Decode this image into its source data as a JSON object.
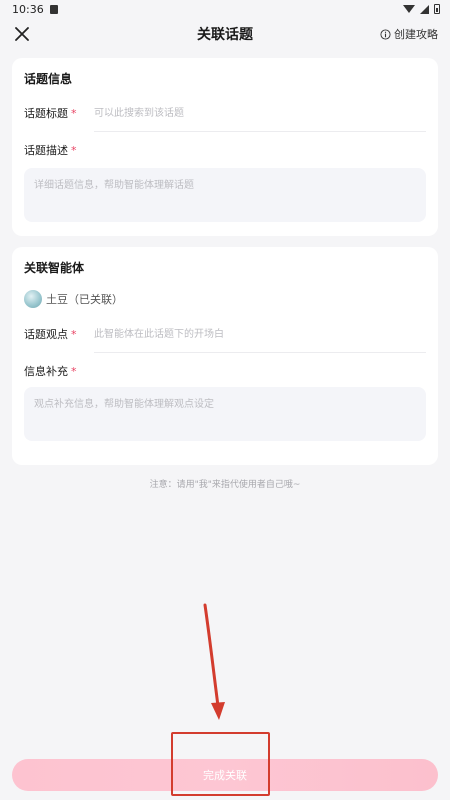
{
  "status_bar": {
    "time": "10:36"
  },
  "header": {
    "title": "关联话题",
    "guide_label": "创建攻略"
  },
  "topic_card": {
    "title": "话题信息",
    "title_field": {
      "label": "话题标题",
      "required_mark": "*",
      "placeholder": "可以此搜索到该话题"
    },
    "desc_field": {
      "label": "话题描述",
      "required_mark": "*",
      "placeholder": "详细话题信息，帮助智能体理解话题"
    }
  },
  "agent_card": {
    "title": "关联智能体",
    "agent_name": "土豆（已关联）",
    "viewpoint_field": {
      "label": "话题观点",
      "required_mark": "*",
      "placeholder": "此智能体在此话题下的开场白"
    },
    "supplement_field": {
      "label": "信息补充",
      "required_mark": "*",
      "placeholder": "观点补充信息，帮助智能体理解观点设定"
    }
  },
  "note": "注意：请用\"我\"来指代使用者自己哦~",
  "submit_label": "完成关联",
  "colors": {
    "accent": "#e84363",
    "button": "#fdc3d0",
    "annotation": "#d33c2e"
  }
}
